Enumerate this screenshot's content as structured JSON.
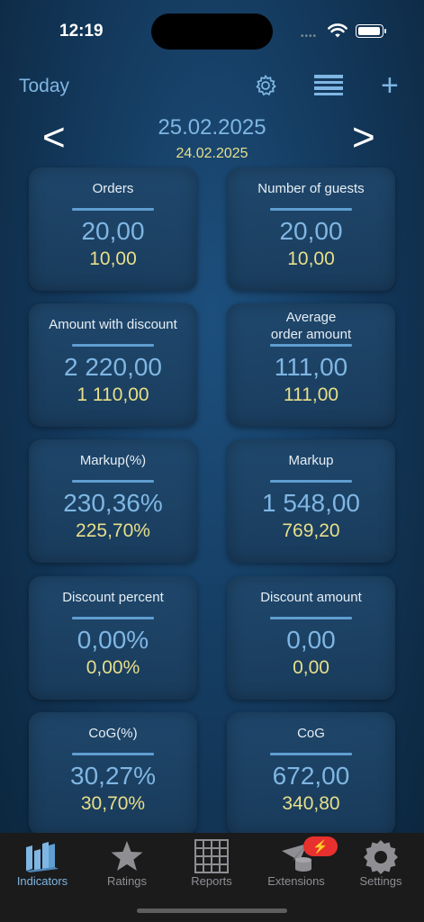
{
  "status": {
    "time": "12:19",
    "signal": "••••"
  },
  "header": {
    "today_label": "Today",
    "settings_icon": "gear-icon",
    "list_icon": "list-icon",
    "add_icon": "plus-icon"
  },
  "nav": {
    "prev": "<",
    "next": ">",
    "date": "25.02.2025",
    "compare_date": "24.02.2025"
  },
  "colors": {
    "accent": "#7fb6e3",
    "compare": "#e8df8a",
    "badge": "#e8302e"
  },
  "cards": [
    {
      "title": "Orders",
      "value": "20,00",
      "compare": "10,00"
    },
    {
      "title": "Number of guests",
      "value": "20,00",
      "compare": "10,00"
    },
    {
      "title": "Amount with discount",
      "value": "2 220,00",
      "compare": "1 110,00"
    },
    {
      "title": "Average\norder amount",
      "value": "111,00",
      "compare": "111,00"
    },
    {
      "title": "Markup(%)",
      "value": "230,36%",
      "compare": "225,70%"
    },
    {
      "title": "Markup",
      "value": "1 548,00",
      "compare": "769,20"
    },
    {
      "title": "Discount percent",
      "value": "0,00%",
      "compare": "0,00%"
    },
    {
      "title": "Discount amount",
      "value": "0,00",
      "compare": "0,00"
    },
    {
      "title": "CoG(%)",
      "value": "30,27%",
      "compare": "30,70%"
    },
    {
      "title": "CoG",
      "value": "672,00",
      "compare": "340,80"
    }
  ],
  "tabs": [
    {
      "label": "Indicators",
      "icon": "indicators-icon",
      "active": true
    },
    {
      "label": "Ratings",
      "icon": "star-icon"
    },
    {
      "label": "Reports",
      "icon": "grid-icon"
    },
    {
      "label": "Extensions",
      "icon": "extensions-icon",
      "badge": "⚡"
    },
    {
      "label": "Settings",
      "icon": "gear-icon"
    }
  ]
}
